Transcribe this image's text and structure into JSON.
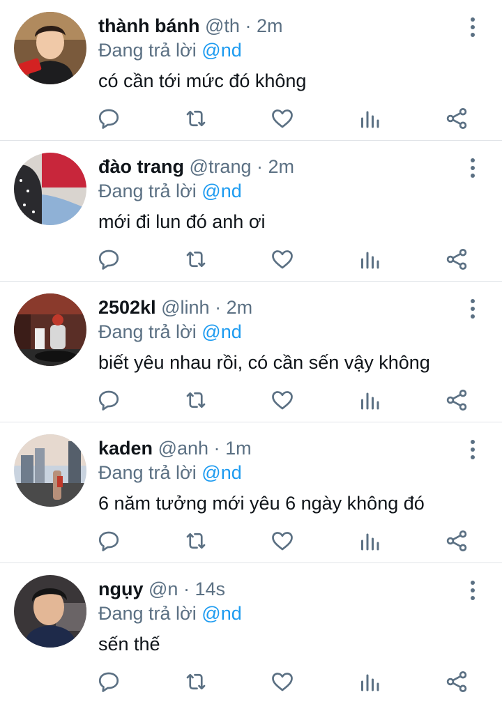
{
  "replying_prefix": "Đang trả lời",
  "replies": [
    {
      "name": "thành bánh",
      "handle": "@th",
      "separator": "·",
      "time": "2m",
      "reply_to": "@nd",
      "text": "có cần tới mức đó không"
    },
    {
      "name": "đào trang",
      "handle": "@trang",
      "separator": "·",
      "time": "2m",
      "reply_to": "@nd",
      "text": "mới đi lun đó anh ơi"
    },
    {
      "name": "2502kl",
      "handle": "@linh",
      "separator": "·",
      "time": "2m",
      "reply_to": "@nd",
      "text": "biết yêu nhau rồi, có cần sến vậy không"
    },
    {
      "name": "kaden",
      "handle": "@anh",
      "separator": "·",
      "time": "1m",
      "reply_to": "@nd",
      "text": "6 năm tưởng mới yêu 6 ngày không đó"
    },
    {
      "name": "ngụy",
      "handle": "@n",
      "separator": "·",
      "time": "14s",
      "reply_to": "@nd",
      "text": "sến thế"
    }
  ],
  "action_icons": [
    "reply-icon",
    "retweet-icon",
    "like-icon",
    "analytics-icon",
    "share-icon"
  ],
  "more_icon": "more-vertical-icon",
  "colors": {
    "text": "#0f1419",
    "secondary": "#5b7083",
    "mention": "#1d9bf0",
    "divider": "#e1e4e8"
  }
}
